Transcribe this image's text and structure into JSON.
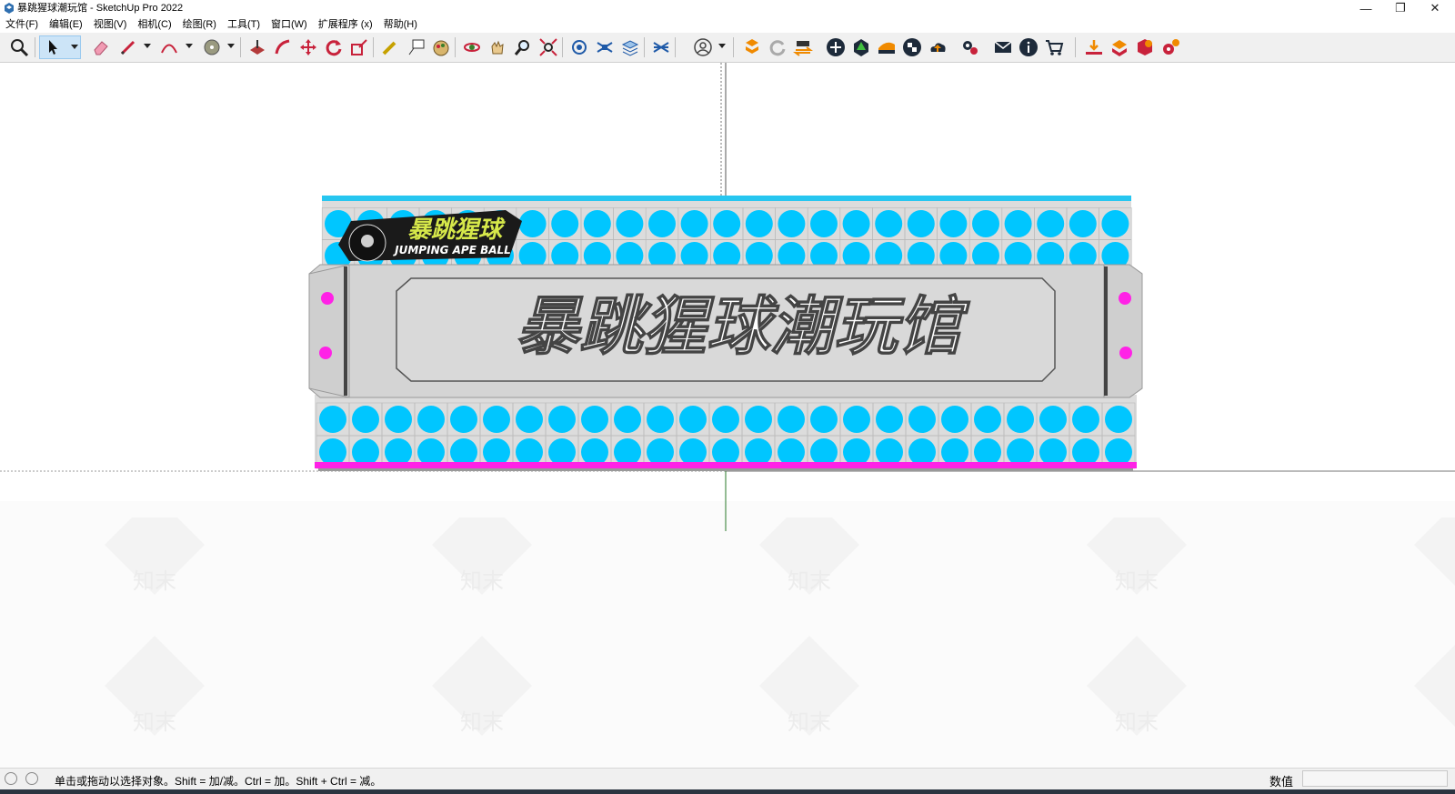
{
  "window": {
    "title": "暴跳猩球潮玩馆 - SketchUp Pro 2022",
    "minimize": "—",
    "maximize": "❐",
    "close": "✕"
  },
  "menu": [
    {
      "label": "文件(F)"
    },
    {
      "label": "编辑(E)"
    },
    {
      "label": "视图(V)"
    },
    {
      "label": "相机(C)"
    },
    {
      "label": "绘图(R)"
    },
    {
      "label": "工具(T)"
    },
    {
      "label": "窗口(W)"
    },
    {
      "label": "扩展程序 (x)"
    },
    {
      "label": "帮助(H)"
    }
  ],
  "toolbar": {
    "icons": [
      "zoom-icon",
      "select-icon",
      "eraser-icon",
      "pencil-icon",
      "arc-icon",
      "paint-bucket-icon",
      "push-pull-icon",
      "follow-me-icon",
      "move-icon",
      "rotate-icon",
      "scale-icon",
      "tape-measure-icon",
      "text-icon",
      "paint-icon",
      "orbit-icon",
      "pan-icon",
      "zoom-window-icon",
      "zoom-extents-icon",
      "layers-icon",
      "outliner-icon",
      "styles-icon",
      "scenes-icon",
      "profile-icon",
      "warehouse-icon",
      "refresh-icon",
      "sync-icon",
      "add-icon",
      "tree-icon",
      "terrain-icon",
      "checker-icon",
      "cloud-upload-icon",
      "gears-icon",
      "mail-icon",
      "info-icon",
      "cart-icon",
      "import-icon",
      "export-icon",
      "plugin-icon",
      "settings-icon"
    ]
  },
  "signboard": {
    "main_text": "暴跳猩球潮玩馆",
    "logo_text": "暴跳猩球",
    "logo_subtext": "JUMPING APE BALL",
    "dot_color": "#00c6ff",
    "accent_color": "#ff00e6"
  },
  "watermark": {
    "text": "知末"
  },
  "status": {
    "hint": "单击或拖动以选择对象。Shift = 加/减。Ctrl = 加。Shift + Ctrl = 减。",
    "vcb_label": "数值",
    "vcb_value": ""
  }
}
